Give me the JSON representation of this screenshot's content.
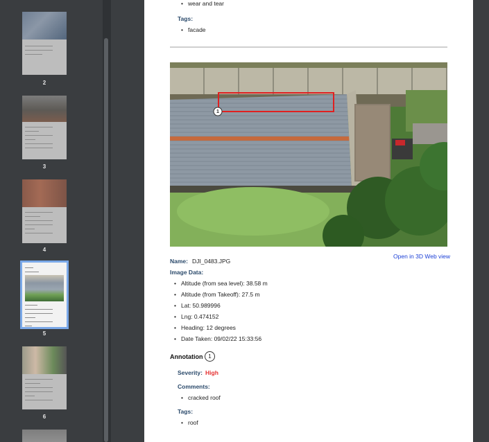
{
  "sidebar": {
    "thumbnails": [
      {
        "page": "2"
      },
      {
        "page": "3"
      },
      {
        "page": "4"
      },
      {
        "page": "5",
        "selected": true
      },
      {
        "page": "6"
      }
    ]
  },
  "page": {
    "top_bullets": [
      "wear and tear"
    ],
    "tags_label": "Tags:",
    "top_tags": [
      "facade"
    ],
    "open_3d_link": "Open in 3D Web view",
    "name_label": "Name:",
    "name_value": "DJI_0483.JPG",
    "image_data_label": "Image Data:",
    "image_data": [
      "Altitude (from sea level): 38.58 m",
      "Altitude (from Takeoff): 27.5 m",
      "Lat: 50.989996",
      "Lng: 0.474152",
      "Heading: 12 degrees",
      "Date Taken: 09/02/22 15:33:56"
    ],
    "annotation_label": "Annotation",
    "annotation_number": "1",
    "marker_number": "1",
    "severity_label": "Severity:",
    "severity_value": "High",
    "comments_label": "Comments:",
    "comments": [
      "cracked roof"
    ],
    "tags_label_2": "Tags:",
    "tags": [
      "roof"
    ]
  },
  "colors": {
    "label": "#2b4a6b",
    "severity_high": "#e53030",
    "link": "#1a3fd6",
    "annotation_box": "#e01f1f",
    "selection": "#7aa8e8"
  }
}
